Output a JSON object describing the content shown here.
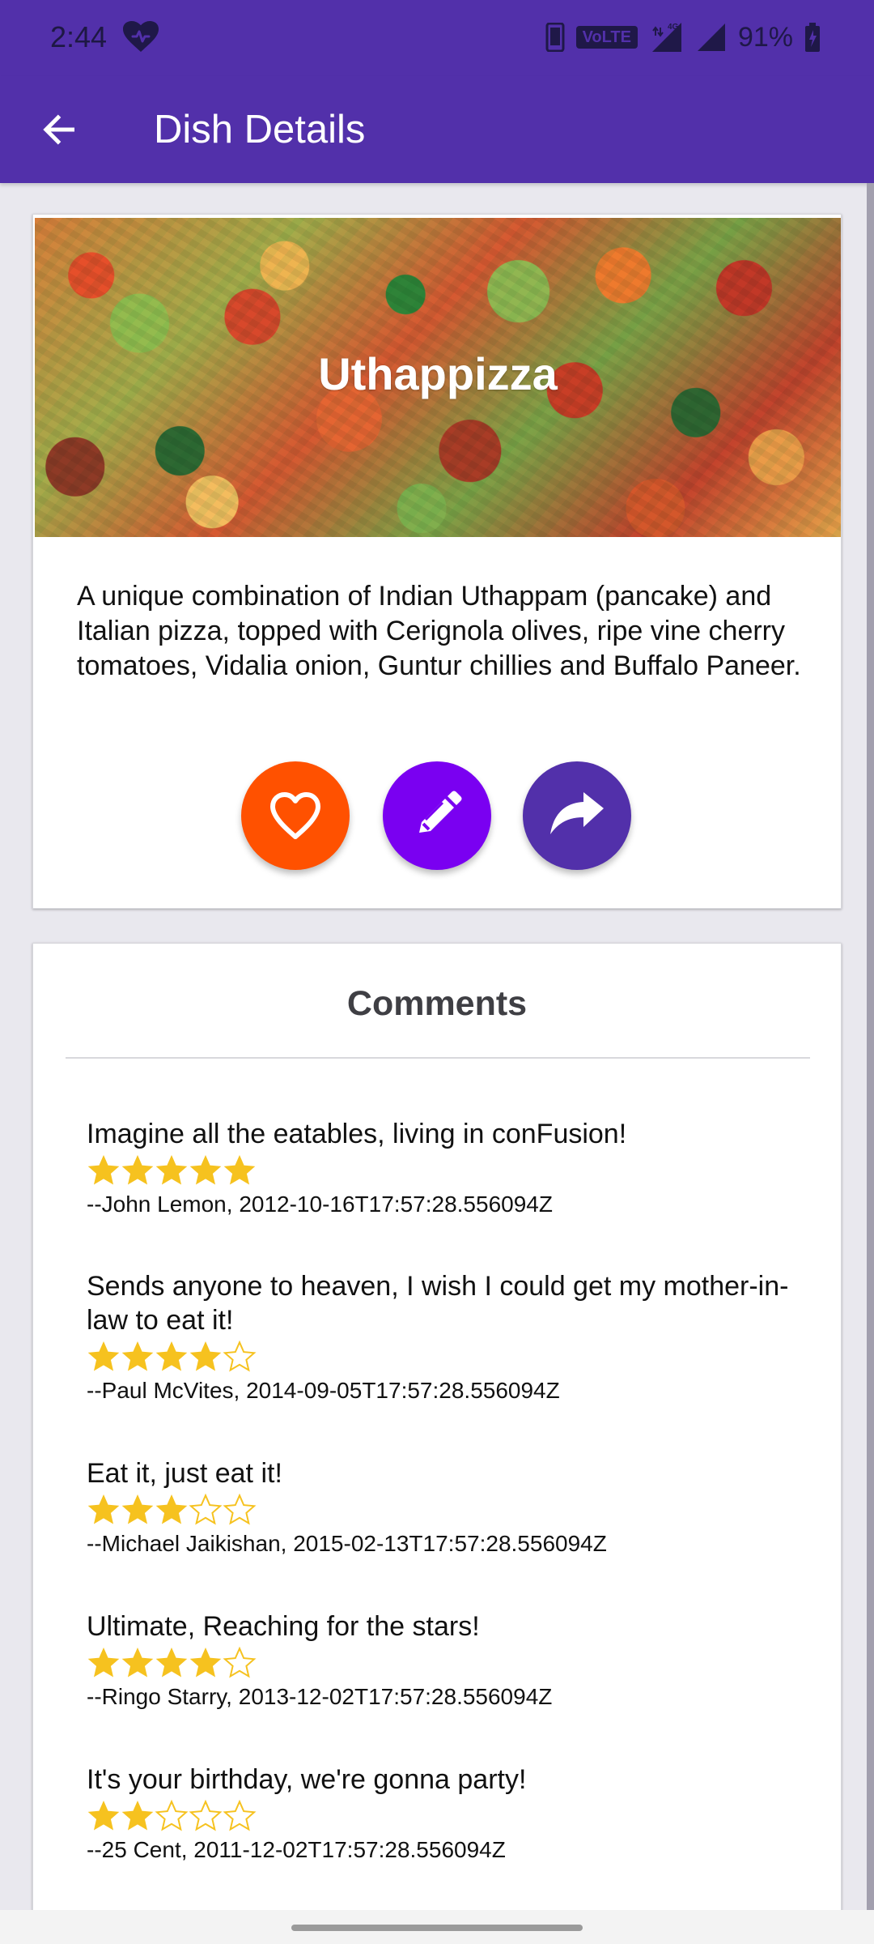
{
  "status_bar": {
    "time": "2:44",
    "volte": "VoLTE",
    "network": "4G",
    "battery": "91%"
  },
  "app_bar": {
    "title": "Dish Details",
    "back_icon": "arrow-left-icon"
  },
  "dish": {
    "name": "Uthappizza",
    "description": "A unique combination of Indian Uthappam (pancake) and Italian pizza, topped with Cerignola olives, ripe vine cherry tomatoes, Vidalia onion, Guntur chillies and Buffalo Paneer.",
    "actions": [
      {
        "name": "favorite",
        "icon": "heart-icon",
        "color": "#ff5100"
      },
      {
        "name": "edit",
        "icon": "pencil-icon",
        "color": "#7a00f1"
      },
      {
        "name": "share",
        "icon": "share-icon",
        "color": "#5230aa"
      }
    ]
  },
  "comments": {
    "title": "Comments",
    "items": [
      {
        "text": "Imagine all the eatables, living in conFusion!",
        "rating": 5,
        "meta": "--John Lemon, 2012-10-16T17:57:28.556094Z"
      },
      {
        "text": "Sends anyone to heaven, I wish I could get my mother-in-law to eat it!",
        "rating": 4,
        "meta": "--Paul McVites, 2014-09-05T17:57:28.556094Z"
      },
      {
        "text": "Eat it, just eat it!",
        "rating": 3,
        "meta": "--Michael Jaikishan, 2015-02-13T17:57:28.556094Z"
      },
      {
        "text": "Ultimate, Reaching for the stars!",
        "rating": 4,
        "meta": "--Ringo Starry, 2013-12-02T17:57:28.556094Z"
      },
      {
        "text": "It's your birthday, we're gonna party!",
        "rating": 2,
        "meta": "--25 Cent, 2011-12-02T17:57:28.556094Z"
      }
    ]
  },
  "colors": {
    "primary": "#5230aa",
    "favorite": "#ff5100",
    "edit": "#7a00f1",
    "star": "#f6c21f",
    "background": "#e9e8ee"
  }
}
